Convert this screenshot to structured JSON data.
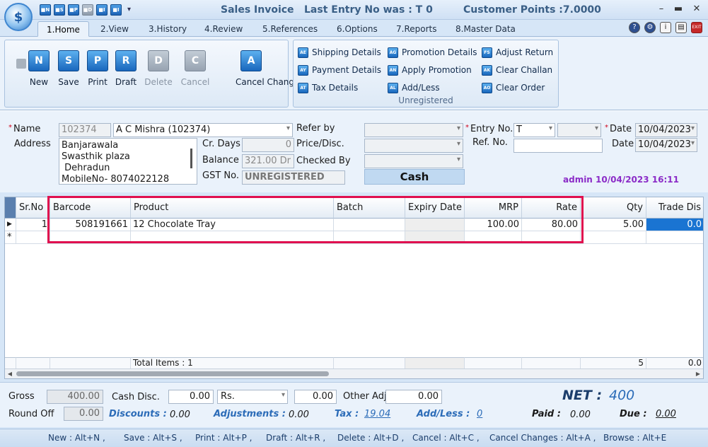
{
  "window": {
    "title": "Sales Invoice",
    "last_entry": "Last Entry No was : T 0",
    "customer_points": "Customer Points :7.0000",
    "quick_access": [
      "■N",
      "■S",
      "■P",
      "■D",
      "■I",
      "■I"
    ]
  },
  "tabs": [
    "1.Home",
    "2.View",
    "3.History",
    "4.Review",
    "5.References",
    "6.Options",
    "7.Reports",
    "8.Master Data"
  ],
  "ribbon": {
    "big_buttons": [
      {
        "label": "New",
        "icon": "N"
      },
      {
        "label": "Save",
        "icon": "S"
      },
      {
        "label": "Print",
        "icon": "P"
      },
      {
        "label": "Draft",
        "icon": "R"
      },
      {
        "label": "Delete",
        "icon": "D"
      },
      {
        "label": "Cancel",
        "icon": "C"
      },
      {
        "label": "Cancel Changes",
        "icon": "A"
      }
    ],
    "small_buttons": [
      {
        "label": "Shipping Details",
        "icon": "AE"
      },
      {
        "label": "Payment Details",
        "icon": "AY"
      },
      {
        "label": "Tax Details",
        "icon": "AT"
      },
      {
        "label": "Promotion Details",
        "icon": "AG"
      },
      {
        "label": "Apply Promotion",
        "icon": "AN"
      },
      {
        "label": "Add/Less",
        "icon": "AL"
      },
      {
        "label": "Adjust Return",
        "icon": "FS"
      },
      {
        "label": "Clear Challan",
        "icon": "AK"
      },
      {
        "label": "Clear Order",
        "icon": "AO"
      }
    ],
    "group_caption": "Unregistered"
  },
  "header": {
    "name_label": "Name",
    "name_code": "102374",
    "name_value": "A C Mishra (102374)",
    "address_label": "Address",
    "address_lines": [
      "Banjarawala",
      "Swasthik plaza",
      " Dehradun",
      "MobileNo- 8074022128"
    ],
    "cr_days_label": "Cr. Days",
    "cr_days_value": "0",
    "balance_label": "Balance",
    "balance_value": "321.00 Dr",
    "gst_label": "GST No.",
    "gst_value": "UNREGISTERED",
    "refer_by_label": "Refer by",
    "price_disc_label": "Price/Disc.",
    "checked_by_label": "Checked By",
    "cash_label": "Cash",
    "entry_no_label": "Entry No.",
    "entry_no_value": "T",
    "ref_no_label": "Ref. No.",
    "date_label": "Date",
    "date1": "10/04/2023",
    "date2": "10/04/2023",
    "admin_stamp": "admin 10/04/2023 16:11"
  },
  "grid": {
    "columns": [
      "Sr.No",
      "Barcode",
      "Product",
      "Batch",
      "Expiry Date",
      "MRP",
      "Rate",
      "Qty",
      "Trade Dis"
    ],
    "rows": [
      {
        "srno": "1",
        "barcode": "508191661",
        "product": "12 Chocolate Tray",
        "batch": "",
        "expiry": "",
        "mrp": "100.00",
        "rate": "80.00",
        "qty": "5.00",
        "trade_dis": "0.0"
      }
    ],
    "new_row_marker": "*",
    "footer": {
      "total_items": "Total Items : 1",
      "qty_total": "5",
      "trade_total": "0.0"
    }
  },
  "totals": {
    "gross_label": "Gross",
    "gross_value": "400.00",
    "cash_disc_label": "Cash Disc.",
    "cash_disc_value": "0.00",
    "cash_disc_unit": "Rs.",
    "cash_disc_amount": "0.00",
    "other_adj_label": "Other Adj.",
    "other_adj_value": "0.00",
    "round_off_label": "Round Off",
    "round_off_value": "0.00",
    "discounts_label": "Discounts :",
    "discounts_value": "0.00",
    "adjustments_label": "Adjustments :",
    "adjustments_value": "0.00",
    "tax_label": "Tax :",
    "tax_value": "19.04",
    "addless_label": "Add/Less :",
    "addless_value": "0",
    "paid_label": "Paid :",
    "paid_value": "0.00",
    "due_label": "Due :",
    "due_value": "0.00",
    "net_label": "NET :",
    "net_value": "400"
  },
  "shortcuts": [
    "New : Alt+N ,",
    "Save : Alt+S ,",
    "Print : Alt+P ,",
    "Draft : Alt+R ,",
    "Delete : Alt+D ,",
    "Cancel : Alt+C ,",
    "Cancel Changes : Alt+A ,",
    "Browse : Alt+E"
  ],
  "colors": {
    "accent": "#1a74d2",
    "highlight_border": "#e0104f",
    "admin_text": "#8b2bc7",
    "net_text": "#2c6cb8"
  }
}
